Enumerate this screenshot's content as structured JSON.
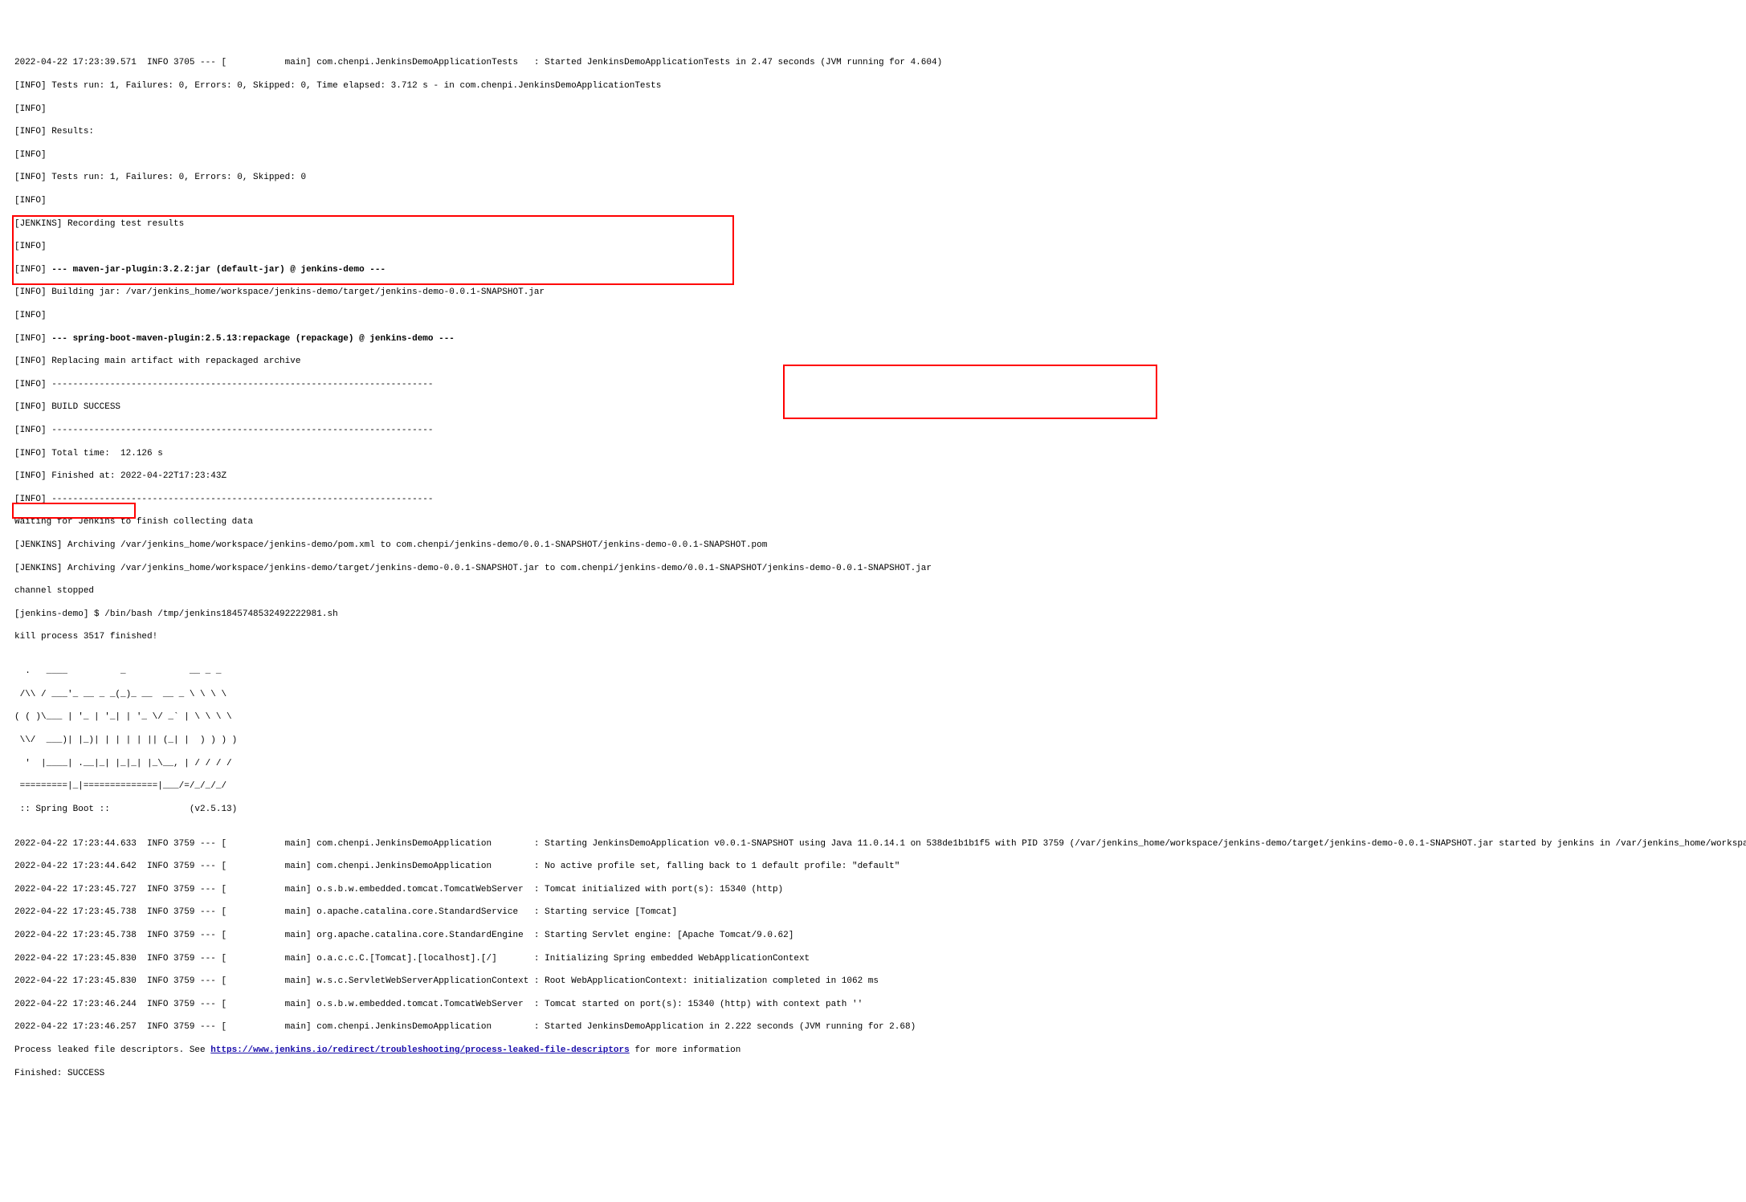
{
  "lines": {
    "l00": "2022-04-22 17:23:39.571  INFO 3705 --- [           main] com.chenpi.JenkinsDemoApplicationTests   : Started JenkinsDemoApplicationTests in 2.47 seconds (JVM running for 4.604)",
    "l01": "[INFO] Tests run: 1, Failures: 0, Errors: 0, Skipped: 0, Time elapsed: 3.712 s - in com.chenpi.JenkinsDemoApplicationTests",
    "l02": "[INFO] ",
    "l03": "[INFO] Results:",
    "l04": "[INFO] ",
    "l05": "[INFO] Tests run: 1, Failures: 0, Errors: 0, Skipped: 0",
    "l06": "[INFO] ",
    "l07": "[JENKINS] Recording test results",
    "l08": "[INFO] ",
    "l09a": "[INFO] ",
    "l09b": "--- maven-jar-plugin:3.2.2:jar (default-jar) @ jenkins-demo ---",
    "l10": "[INFO] Building jar: /var/jenkins_home/workspace/jenkins-demo/target/jenkins-demo-0.0.1-SNAPSHOT.jar",
    "l11": "[INFO] ",
    "l12a": "[INFO] ",
    "l12b": "--- spring-boot-maven-plugin:2.5.13:repackage (repackage) @ jenkins-demo ---",
    "l13": "[INFO] Replacing main artifact with repackaged archive",
    "l14": "[INFO] ------------------------------------------------------------------------",
    "l15": "[INFO] BUILD SUCCESS",
    "l16": "[INFO] ------------------------------------------------------------------------",
    "l17": "[INFO] Total time:  12.126 s",
    "l18": "[INFO] Finished at: 2022-04-22T17:23:43Z",
    "l19": "[INFO] ------------------------------------------------------------------------",
    "l20": "Waiting for Jenkins to finish collecting data",
    "l21": "[JENKINS] Archiving /var/jenkins_home/workspace/jenkins-demo/pom.xml to com.chenpi/jenkins-demo/0.0.1-SNAPSHOT/jenkins-demo-0.0.1-SNAPSHOT.pom",
    "l22": "[JENKINS] Archiving /var/jenkins_home/workspace/jenkins-demo/target/jenkins-demo-0.0.1-SNAPSHOT.jar to com.chenpi/jenkins-demo/0.0.1-SNAPSHOT/jenkins-demo-0.0.1-SNAPSHOT.jar",
    "l23": "channel stopped",
    "l24": "[jenkins-demo] $ /bin/bash /tmp/jenkins1845748532492222981.sh",
    "l25": "kill process 3517 finished!",
    "l26": "",
    "l27": "  .   ____          _            __ _ _",
    "l28": " /\\\\ / ___'_ __ _ _(_)_ __  __ _ \\ \\ \\ \\",
    "l29": "( ( )\\___ | '_ | '_| | '_ \\/ _` | \\ \\ \\ \\",
    "l30": " \\\\/  ___)| |_)| | | | | || (_| |  ) ) ) )",
    "l31": "  '  |____| .__|_| |_|_| |_\\__, | / / / /",
    "l32": " =========|_|==============|___/=/_/_/_/",
    "l33": " :: Spring Boot ::               (v2.5.13)",
    "l34": "",
    "l35": "2022-04-22 17:23:44.633  INFO 3759 --- [           main] com.chenpi.JenkinsDemoApplication        : Starting JenkinsDemoApplication v0.0.1-SNAPSHOT using Java 11.0.14.1 on 538de1b1b1f5 with PID 3759 (/var/jenkins_home/workspace/jenkins-demo/target/jenkins-demo-0.0.1-SNAPSHOT.jar started by jenkins in /var/jenkins_home/workspace/jenkins-demo/target)",
    "l36": "2022-04-22 17:23:44.642  INFO 3759 --- [           main] com.chenpi.JenkinsDemoApplication        : No active profile set, falling back to 1 default profile: \"default\"",
    "l37": "2022-04-22 17:23:45.727  INFO 3759 --- [           main] o.s.b.w.embedded.tomcat.TomcatWebServer  : Tomcat initialized with port(s): 15340 (http)",
    "l38": "2022-04-22 17:23:45.738  INFO 3759 --- [           main] o.apache.catalina.core.StandardService   : Starting service [Tomcat]",
    "l39": "2022-04-22 17:23:45.738  INFO 3759 --- [           main] org.apache.catalina.core.StandardEngine  : Starting Servlet engine: [Apache Tomcat/9.0.62]",
    "l40": "2022-04-22 17:23:45.830  INFO 3759 --- [           main] o.a.c.c.C.[Tomcat].[localhost].[/]       : Initializing Spring embedded WebApplicationContext",
    "l41": "2022-04-22 17:23:45.830  INFO 3759 --- [           main] w.s.c.ServletWebServerApplicationContext : Root WebApplicationContext: initialization completed in 1062 ms",
    "l42": "2022-04-22 17:23:46.244  INFO 3759 --- [           main] o.s.b.w.embedded.tomcat.TomcatWebServer  : Tomcat started on port(s): 15340 (http) with context path ''",
    "l43": "2022-04-22 17:23:46.257  INFO 3759 --- [           main] com.chenpi.JenkinsDemoApplication        : Started JenkinsDemoApplication in 2.222 seconds (JVM running for 2.68)",
    "l44a": "Process leaked file descriptors. See ",
    "l44b": "https://www.jenkins.io/redirect/troubleshooting/process-leaked-file-descriptors",
    "l44c": " for more information",
    "l45": "Finished: SUCCESS"
  }
}
